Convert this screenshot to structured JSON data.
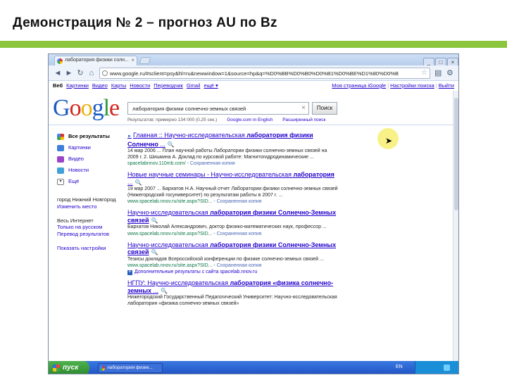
{
  "slide": {
    "title": "Демонстрация № 2 – прогноз AU по Bz"
  },
  "browser": {
    "tab_title": "лаборатория физики солн...",
    "tab_close": "×",
    "url": "www.google.ru/#sclient=psy&hl=ru&newwindow=1&source=hp&q=%D0%BB%D0%B0%D0%B1%D0%BE%D1%80%D0%B",
    "window_buttons": [
      "_",
      "□",
      "×"
    ]
  },
  "google_bar": {
    "left": [
      "Веб",
      "Картинки",
      "Видео",
      "Карты",
      "Новости",
      "Переводчик",
      "Gmail",
      "ещё ▾"
    ],
    "right": [
      "Моя страница iGoogle",
      "Настройки поиска",
      "Выйти"
    ]
  },
  "logo": {
    "letters": [
      "G",
      "o",
      "o",
      "g",
      "l",
      "e"
    ]
  },
  "search": {
    "query": "лаборатория физики солнечно-земных связей",
    "clear": "×",
    "button": "Поиск",
    "stats": "Результатов: примерно 134 000 (0,25 сек.)",
    "link_english": "Google.com in English",
    "link_advanced": "Расширенный поиск"
  },
  "sidebar": {
    "items": [
      {
        "label": "Все результаты",
        "icon": "all-results-icon"
      },
      {
        "label": "Картинки",
        "icon": "images-icon"
      },
      {
        "label": "Видео",
        "icon": "video-icon"
      },
      {
        "label": "Новости",
        "icon": "news-icon"
      },
      {
        "label": "Ещё",
        "icon": "more-icon"
      }
    ],
    "location_label": "город Нижний Новгород",
    "location_change": "Изменить место",
    "web_label": "Весь Интернет",
    "lang_link": "Только на русском",
    "translate_link": "Перевод результатов",
    "settings_link": "Показать настройки"
  },
  "results": [
    {
      "title_pre": "Главная :: Научно-исследовательская ",
      "title_bold": "лаборатория физики Солнечно",
      "title_post": " ...",
      "snippet": "14 мар 2006 ... План научной работы Лаборатории физики солнечно-земных связей на 2009 г. 2. Шишкина А. Доклад по курсовой работе: Магнитогидродинамические ...",
      "url": "spacelabnnov.110mb.com/",
      "cache": "Сохраненная копия"
    },
    {
      "title_pre": "Новые научные семинары - Научно-исследовательская ",
      "title_bold": "лаборатория",
      "title_post": " ...",
      "snippet": "19 мар 2007 ... Бархатов Н.А. Научный отчет Лаборатории физики солнечно-земных связей (Нижегородский госуниверситет) по результатам работы в 2007 г. ...",
      "url": "www.spacelab.nnov.ru/site.aspx?SID...",
      "cache": "Сохраненная копия"
    },
    {
      "title_pre": "Научно-исследовательская ",
      "title_bold": "лаборатория физики Солнечно-Земных связей",
      "title_post": "",
      "snippet": "Бархатов Николай Александрович, доктор физико-математических наук, профессор ...",
      "url": "www.spacelab.nnov.ru/site.aspx?SID...",
      "cache": "Сохраненная копия"
    },
    {
      "title_pre": "Научно-исследовательская ",
      "title_bold": "лаборатория физики Солнечно-Земных связей",
      "title_post": "",
      "snippet": "Тезисы докладов Всероссийской конференции по физике солнечно-земных связей ...",
      "url": "www.spacelab.nnov.ru/site.aspx?SID...",
      "cache": "Сохраненная копия",
      "more": "Дополнительные результаты с сайта spacelab.nnov.ru"
    },
    {
      "title_pre": "НГПУ: Научно-исследовательская ",
      "title_bold": "лаборатория «физика солнечно-земных",
      "title_post": " ...",
      "snippet": "Нижегородский Государственный Педагогический Университет: Научно-исследовательская лаборатория «физика солнечно-земных связей»",
      "url": "",
      "cache": ""
    }
  ],
  "taskbar": {
    "start": "пуск",
    "task": "лаборатория физик...",
    "lang": "EN"
  }
}
